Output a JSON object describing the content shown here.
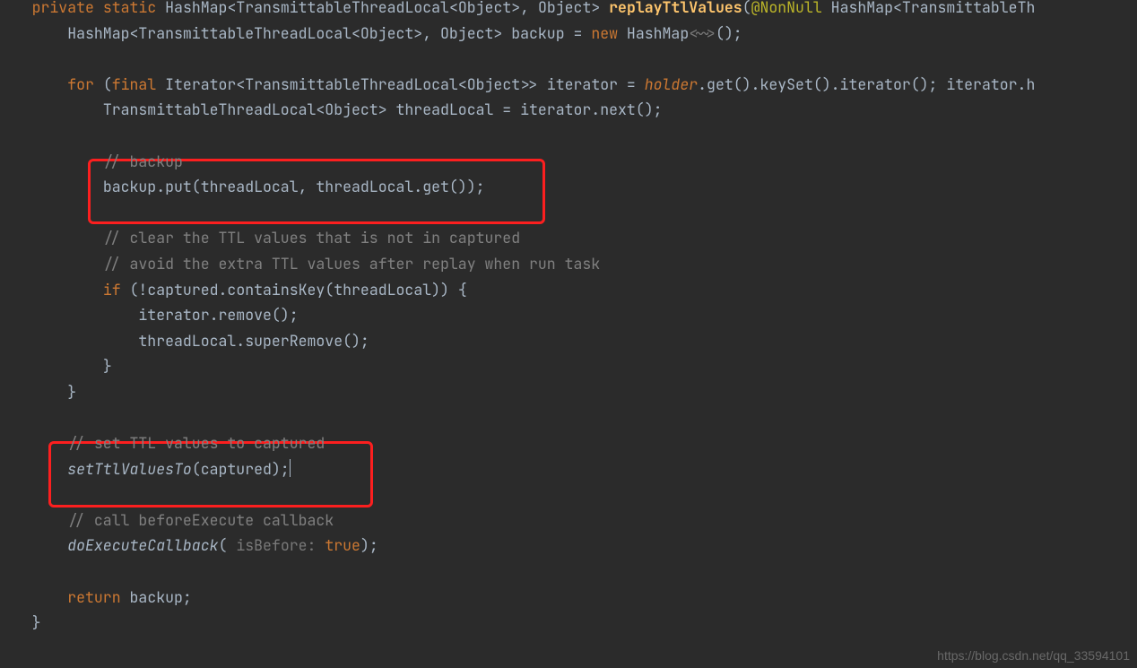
{
  "code": {
    "line01": {
      "kw1": "private",
      "kw2": "static",
      "ret": "HashMap<TransmittableThreadLocal<Object>, Object>",
      "name": "replayTtlValues",
      "ann": "@NonNull",
      "param": "HashMap<TransmittableTh"
    },
    "line02": {
      "type": "HashMap<TransmittableThreadLocal<Object>, Object> backup = ",
      "kw": "new ",
      "ctor": "HashMap",
      "diamond": "<~>",
      "rest": "();"
    },
    "line04": {
      "kw": "for ",
      "open": "(",
      "final": "final ",
      "decl": "Iterator<TransmittableThreadLocal<Object>> iterator = ",
      "holder": "holder",
      "rest": ".get().keySet().iterator(); iterator.h"
    },
    "line05": {
      "decl": "TransmittableThreadLocal<Object> threadLocal = iterator.next();"
    },
    "line07": {
      "comment": "// backup"
    },
    "line08": {
      "stmt": "backup.put(threadLocal, threadLocal.get());"
    },
    "line10": {
      "comment": "// clear the TTL values that is not in captured"
    },
    "line11": {
      "comment": "// avoid the extra TTL values after replay when run task"
    },
    "line12": {
      "kw": "if ",
      "cond": "(!captured.containsKey(threadLocal)) {"
    },
    "line13": {
      "stmt": "iterator.remove();"
    },
    "line14": {
      "stmt": "threadLocal.superRemove();"
    },
    "line15": {
      "brace": "}"
    },
    "line16": {
      "brace": "}"
    },
    "line18": {
      "comment": "// set TTL values to captured"
    },
    "line19": {
      "call": "setTtlValuesTo",
      "args": "(captured);"
    },
    "line21": {
      "comment": "// call beforeExecute callback"
    },
    "line22": {
      "call": "doExecuteCallback",
      "open": "( ",
      "hint": "isBefore: ",
      "val": "true",
      "close": ");"
    },
    "line24": {
      "kw": "return ",
      "var": "backup;"
    },
    "line25": {
      "brace": "}"
    }
  },
  "watermark": "https://blog.csdn.net/qq_33594101"
}
